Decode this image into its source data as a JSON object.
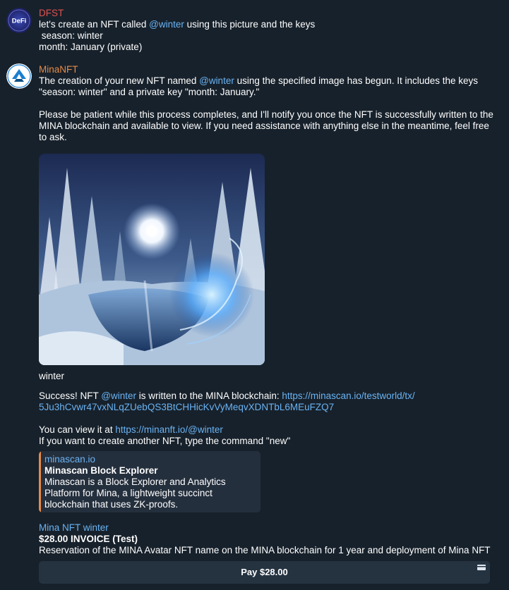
{
  "messages": [
    {
      "sender": "DFST",
      "avatar_text": "DeFi",
      "parts": [
        "let's create an NFT called ",
        "@winter",
        " using this picture and the keys"
      ],
      "lines": [
        " season: winter",
        "month: January (private)"
      ]
    },
    {
      "sender": "MinaNFT",
      "p1_parts": [
        "The creation of your new NFT named ",
        "@winter",
        " using the specified image has begun. It includes the keys"
      ],
      "p1_line2": "\"season: winter\" and a private key \"month: January.\"",
      "p2_lines": [
        "Please be patient while this process completes, and I'll notify you once the NFT is successfully written to the",
        "MINA blockchain and available to view. If you need assistance with anything else in the meantime, feel free",
        "to ask."
      ],
      "caption": "winter",
      "success_parts": [
        "Success! NFT ",
        "@winter",
        " is written to the MINA blockchain: ",
        "https://minascan.io/testworld/tx/"
      ],
      "success_link2": "5Ju3hCvwr47vxNLqZUebQS3BtCHHicKvVyMeqvXDNTbL6MEuFZQ7",
      "view_parts": [
        "You can view it at ",
        "https://minanft.io/@winter"
      ],
      "create_line": "If you want to create another NFT, type the command \"new\"",
      "preview": {
        "site": "minascan.io",
        "title": "Minascan Block Explorer",
        "desc_lines": [
          "Minascan is a Block Explorer and Analytics",
          "Platform for Mina, a lightweight succinct",
          "blockchain that uses ZK-proofs."
        ]
      },
      "invoice": {
        "name": "Mina NFT winter",
        "amount": "$28.00 INVOICE (Test)",
        "description": "Reservation of the MINA Avatar NFT name on the MINA blockchain for 1 year and deployment of Mina NFT",
        "pay_label": "Pay $28.00"
      }
    }
  ],
  "colors": {
    "background": "#17212b",
    "link": "#6ab3f3",
    "sender1": "#e2524f",
    "sender2": "#e68a48"
  }
}
